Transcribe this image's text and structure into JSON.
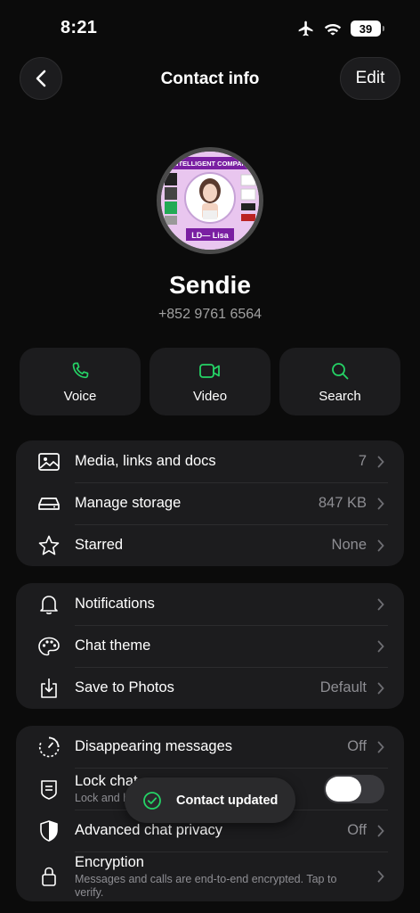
{
  "status": {
    "time": "8:21",
    "battery": "39"
  },
  "nav": {
    "title": "Contact info",
    "edit_label": "Edit"
  },
  "avatar": {
    "banner_text": "INTELLIGENT COMPANI",
    "tag_text": "LD— Lisa"
  },
  "contact": {
    "name": "Sendie",
    "phone": "+852 9761 6564"
  },
  "actions": [
    {
      "label": "Voice",
      "icon": "phone-icon"
    },
    {
      "label": "Video",
      "icon": "video-icon"
    },
    {
      "label": "Search",
      "icon": "search-icon"
    }
  ],
  "section1": {
    "media": {
      "label": "Media, links and docs",
      "value": "7"
    },
    "storage": {
      "label": "Manage storage",
      "value": "847 KB"
    },
    "starred": {
      "label": "Starred",
      "value": "None"
    }
  },
  "section2": {
    "notifications": {
      "label": "Notifications"
    },
    "theme": {
      "label": "Chat theme"
    },
    "photos": {
      "label": "Save to Photos",
      "value": "Default"
    }
  },
  "section3": {
    "disappearing": {
      "label": "Disappearing messages",
      "value": "Off"
    },
    "lock": {
      "label": "Lock chat",
      "sub": "Lock and h"
    },
    "privacy": {
      "label": "Advanced chat privacy",
      "value": "Off"
    },
    "encryption": {
      "label": "Encryption",
      "sub": "Messages and calls are end-to-end encrypted. Tap to verify."
    }
  },
  "toast": {
    "text": "Contact updated"
  },
  "colors": {
    "accent": "#25d366",
    "background": "#0b0b0b",
    "card": "#1c1c1e",
    "muted": "#8e8e93"
  }
}
